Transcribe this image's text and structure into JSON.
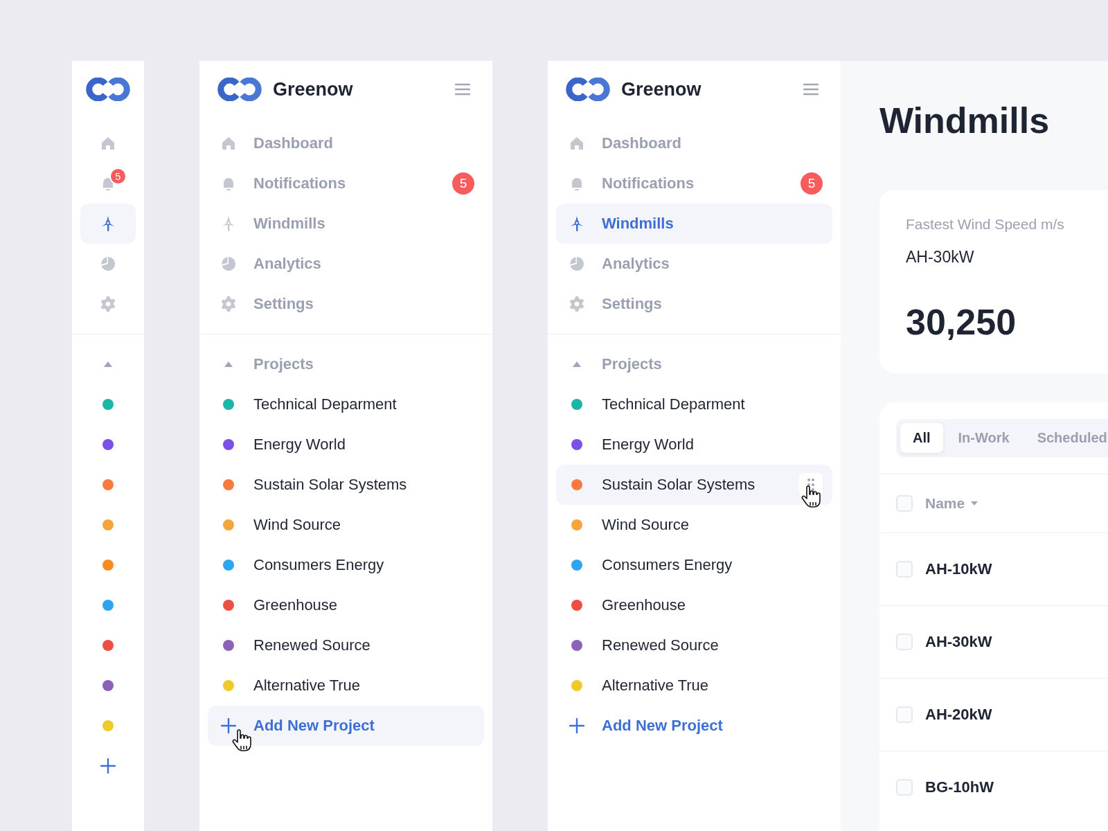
{
  "sidebars": [
    {
      "kind": "collapsed",
      "nav": [
        {
          "kind": "home",
          "selected": false
        },
        {
          "kind": "bell",
          "selected": false,
          "badge": "5"
        },
        {
          "kind": "windmill",
          "selected": true
        },
        {
          "kind": "pie",
          "selected": false
        },
        {
          "kind": "gear",
          "selected": false
        }
      ],
      "projects_header": {
        "expanded": true
      },
      "projects": [
        {
          "color": "#1ab7a6",
          "hovered": false
        },
        {
          "color": "#7b4fe8",
          "hovered": false
        },
        {
          "color": "#f87a3f",
          "hovered": false
        },
        {
          "color": "#f5a63b",
          "hovered": false
        },
        {
          "color": "#fb8a1e",
          "hovered": false
        },
        {
          "color": "#2fa4f0",
          "hovered": false
        },
        {
          "color": "#ec4f44",
          "hovered": false
        },
        {
          "color": "#8c61b8",
          "hovered": false
        },
        {
          "color": "#eecb2a",
          "hovered": false
        }
      ],
      "add": {
        "hovered": false
      }
    },
    {
      "kind": "expanded",
      "brand": "Greenow",
      "nav": [
        {
          "kind": "home",
          "label": "Dashboard",
          "selected": false
        },
        {
          "kind": "bell",
          "label": "Notifications",
          "selected": false,
          "badge": "5"
        },
        {
          "kind": "windmill",
          "label": "Windmills",
          "selected": false
        },
        {
          "kind": "pie",
          "label": "Analytics",
          "selected": false
        },
        {
          "kind": "gear",
          "label": "Settings",
          "selected": false
        }
      ],
      "projects_header": {
        "label": "Projects",
        "expanded": true
      },
      "projects": [
        {
          "name": "Technical Deparment",
          "color": "#1ab7a6",
          "hovered": false
        },
        {
          "name": "Energy World",
          "color": "#7b4fe8",
          "hovered": false
        },
        {
          "name": "Sustain Solar Systems",
          "color": "#f87a3f",
          "hovered": false
        },
        {
          "name": "Wind Source",
          "color": "#f5a63b",
          "hovered": false
        },
        {
          "name": "Consumers Energy",
          "color": "#2fa4f0",
          "hovered": false
        },
        {
          "name": "Greenhouse",
          "color": "#ec4f44",
          "hovered": false
        },
        {
          "name": "Renewed Source",
          "color": "#8c61b8",
          "hovered": false
        },
        {
          "name": "Alternative True",
          "color": "#eecb2a",
          "hovered": false
        }
      ],
      "add": {
        "label": "Add New Project",
        "hovered": true
      }
    },
    {
      "kind": "expanded",
      "brand": "Greenow",
      "nav": [
        {
          "kind": "home",
          "label": "Dashboard",
          "selected": false
        },
        {
          "kind": "bell",
          "label": "Notifications",
          "selected": false,
          "badge": "5"
        },
        {
          "kind": "windmill",
          "label": "Windmills",
          "selected": true
        },
        {
          "kind": "pie",
          "label": "Analytics",
          "selected": false
        },
        {
          "kind": "gear",
          "label": "Settings",
          "selected": false
        }
      ],
      "projects_header": {
        "label": "Projects",
        "expanded": true
      },
      "projects": [
        {
          "name": "Technical Deparment",
          "color": "#1ab7a6",
          "hovered": false
        },
        {
          "name": "Energy World",
          "color": "#7b4fe8",
          "hovered": false
        },
        {
          "name": "Sustain Solar Systems",
          "color": "#f87a3f",
          "hovered": true
        },
        {
          "name": "Wind Source",
          "color": "#f5a63b",
          "hovered": false
        },
        {
          "name": "Consumers Energy",
          "color": "#2fa4f0",
          "hovered": false
        },
        {
          "name": "Greenhouse",
          "color": "#ec4f44",
          "hovered": false
        },
        {
          "name": "Renewed Source",
          "color": "#8c61b8",
          "hovered": false
        },
        {
          "name": "Alternative True",
          "color": "#eecb2a",
          "hovered": false
        }
      ],
      "add": {
        "label": "Add New Project",
        "hovered": false
      }
    }
  ],
  "main": {
    "title": "Windmills",
    "stat": {
      "label": "Fastest Wind Speed m/s",
      "name": "AH-30kW",
      "value": "30,250"
    },
    "tabs": [
      {
        "label": "All",
        "selected": true
      },
      {
        "label": "In-Work",
        "selected": false
      },
      {
        "label": "Scheduled",
        "selected": false
      }
    ],
    "table": {
      "header": {
        "label": "Name",
        "checked": false
      },
      "rows": [
        {
          "name": "AH-10kW",
          "checked": false
        },
        {
          "name": "AH-30kW",
          "checked": false
        },
        {
          "name": "AH-20kW",
          "checked": false
        },
        {
          "name": "BG-10hW",
          "checked": false
        }
      ]
    }
  }
}
